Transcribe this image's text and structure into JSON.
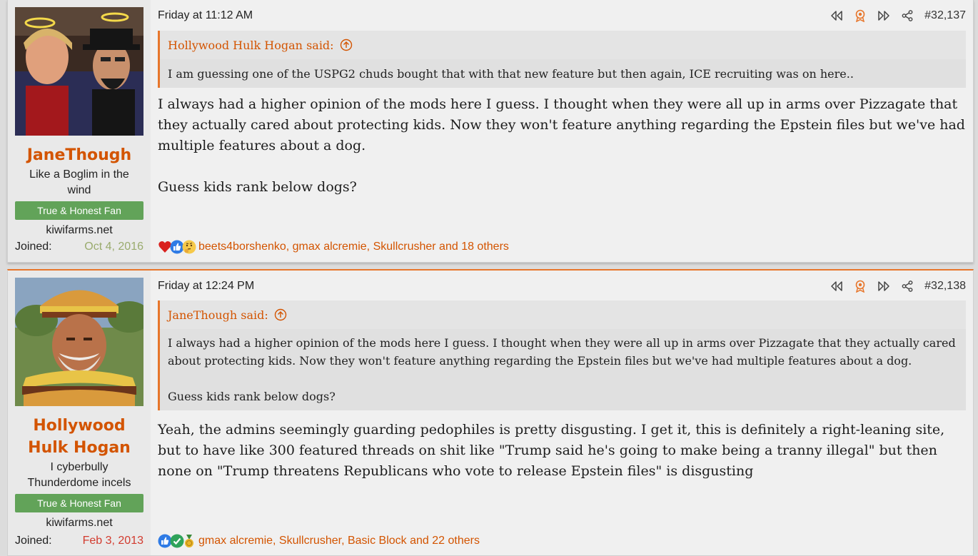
{
  "posts": [
    {
      "author": "JaneThough",
      "user_title": "Like a Boglim in the wind",
      "banner": "True & Honest Fan",
      "site": "kiwifarms.net",
      "joined_label": "Joined:",
      "joined_date": "Oct 4, 2016",
      "date": "Friday at 11:12 AM",
      "post_number": "#32,137",
      "quote_author": "Hollywood Hulk Hogan said:",
      "quote_text": "I am guessing one of the USPG2 chuds bought that with that new feature but then again, ICE recruiting was on here..",
      "body": [
        "I always had a higher opinion of the mods here I guess. I thought when they were all up in arms over Pizzagate that they actually cared about protecting kids. Now they won't feature anything regarding the Epstein files but we've had multiple features about a dog.",
        "Guess kids rank below dogs?"
      ],
      "reactions_icons": [
        "heart-icon",
        "thumbs-up-icon",
        "thinking-icon"
      ],
      "reactions_text": "beets4borshenko, gmax alcremie, Skullcrusher and 18 others"
    },
    {
      "author": "Hollywood Hulk Hogan",
      "user_title": "I cyberbully Thunderdome incels",
      "banner": "True & Honest Fan",
      "site": "kiwifarms.net",
      "joined_label": "Joined:",
      "joined_date": "Feb 3, 2013",
      "date": "Friday at 12:24 PM",
      "post_number": "#32,138",
      "quote_author": "JaneThough said:",
      "quote_text_1": "I always had a higher opinion of the mods here I guess. I thought when they were all up in arms over Pizzagate that they actually cared about protecting kids. Now they won't feature anything regarding the Epstein files but we've had multiple features about a dog.",
      "quote_text_2": "Guess kids rank below dogs?",
      "body": [
        "Yeah, the admins seemingly guarding pedophiles is pretty disgusting. I get it, this is definitely a right-leaning site, but to have like 300 featured threads on shit like \"Trump said he's going to make being a tranny illegal\" but then none on \"Trump threatens Republicans who vote to release Epstein files\" is disgusting"
      ],
      "reactions_icons": [
        "thumbs-up-icon",
        "checkmark-icon",
        "medal-icon"
      ],
      "reactions_text": "gmax alcremie, Skullcrusher, Basic Block and 22 others"
    }
  ],
  "colors": {
    "accent": "#d35400",
    "border_accent": "#e7762b",
    "banner": "#62a359"
  }
}
